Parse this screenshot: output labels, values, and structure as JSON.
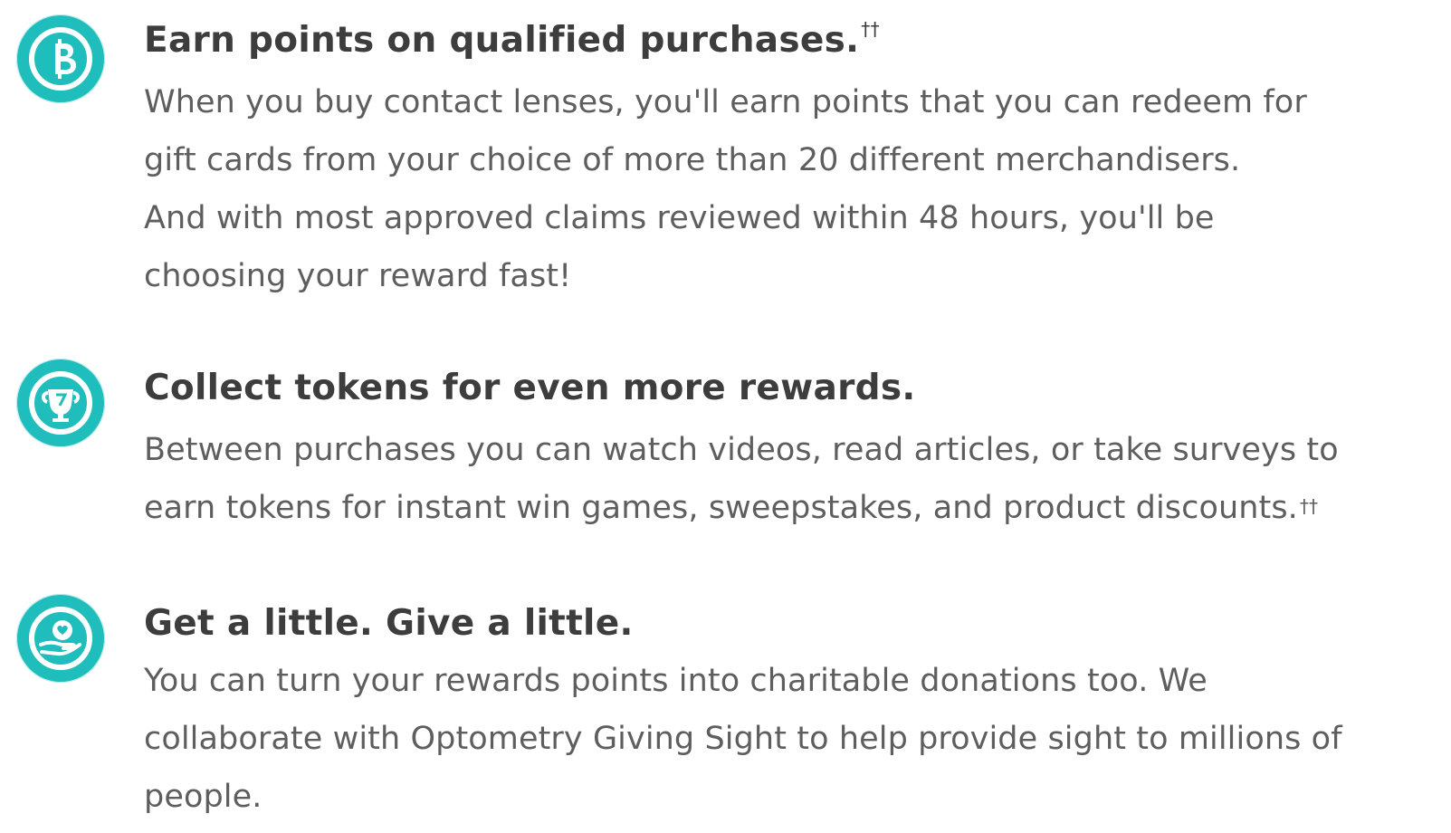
{
  "features": [
    {
      "icon": "coin-b-icon",
      "title": "Earn points on qualified purchases.",
      "title_mark": "††",
      "body_lines": [
        "When you buy contact lenses, you'll earn points that you can redeem for",
        "gift cards from your choice of more than 20 different merchandisers.",
        "And with most approved claims reviewed within 48 hours, you'll be",
        "choosing your reward fast!"
      ]
    },
    {
      "icon": "trophy-cup-icon",
      "title": "Collect tokens for even more rewards.",
      "body_lines": [
        "Between purchases you can watch videos, read articles, or take surveys to",
        "earn tokens for instant win games, sweepstakes, and product discounts."
      ],
      "body_mark": "††"
    },
    {
      "icon": "heart-in-hand-icon",
      "title": "Get a little. Give a little.",
      "body_lines": [
        "You can turn your rewards points into charitable donations too. We",
        "collaborate with Optometry Giving Sight to help provide sight to millions of",
        "people."
      ]
    }
  ],
  "colors": {
    "accent": "#20bdbd",
    "title": "#3d3d3d",
    "body": "#5e5e5e"
  }
}
